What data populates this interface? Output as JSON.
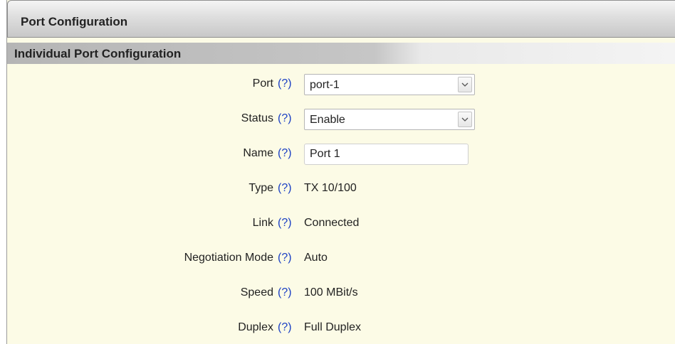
{
  "header": {
    "title": "Port Configuration"
  },
  "section": {
    "title": "Individual Port Configuration"
  },
  "help_label": "(?)",
  "fields": [
    {
      "label": "Port",
      "kind": "select",
      "value": "port-1"
    },
    {
      "label": "Status",
      "kind": "select",
      "value": "Enable"
    },
    {
      "label": "Name",
      "kind": "input",
      "value": "Port 1"
    },
    {
      "label": "Type",
      "kind": "text",
      "value": "TX 10/100"
    },
    {
      "label": "Link",
      "kind": "text",
      "value": "Connected"
    },
    {
      "label": "Negotiation Mode",
      "kind": "text",
      "value": "Auto"
    },
    {
      "label": "Speed",
      "kind": "text",
      "value": "100 MBit/s"
    },
    {
      "label": "Duplex",
      "kind": "text",
      "value": "Full Duplex"
    }
  ],
  "colors": {
    "panel_background": "#fcfbe6",
    "help_link": "#1a3fc4"
  },
  "icons": {
    "dropdown": "chevron-down-icon"
  }
}
